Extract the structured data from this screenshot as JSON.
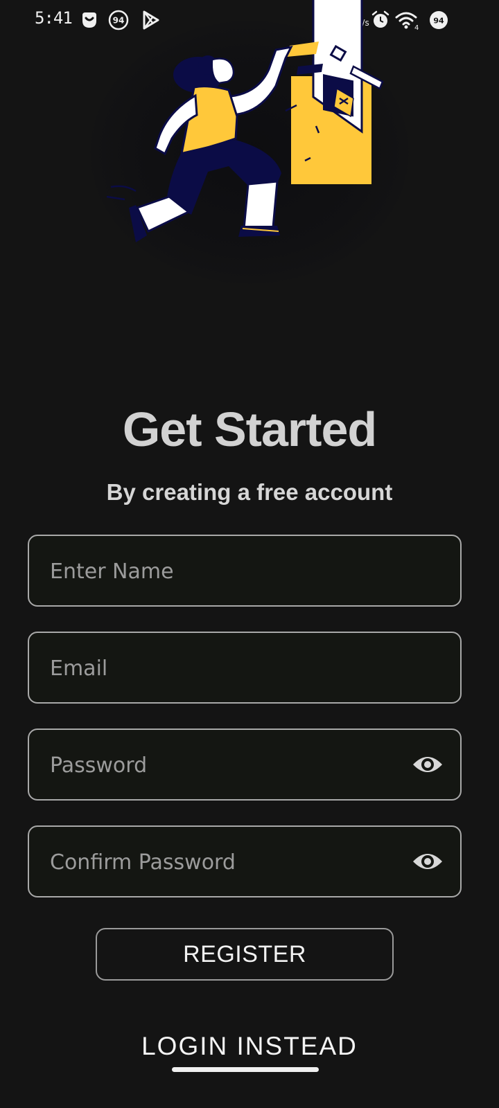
{
  "status_bar": {
    "time": "5:41",
    "net_speed_value": "0",
    "net_speed_unit": "kB/s",
    "notification_badge": "94",
    "battery_level": "94",
    "wifi_level": "4"
  },
  "illustration": {
    "subject": "woman-inserting-card-into-atm",
    "colors": {
      "navy": "#0b0c46",
      "yellow": "#ffc83a",
      "white": "#ffffff"
    }
  },
  "header": {
    "title": "Get Started",
    "subtitle": "By creating a free account"
  },
  "form": {
    "name": {
      "value": "",
      "placeholder": "Enter Name"
    },
    "email": {
      "value": "",
      "placeholder": "Email"
    },
    "password": {
      "value": "",
      "placeholder": "Password",
      "icon": "eye-icon"
    },
    "confirm_password": {
      "value": "",
      "placeholder": "Confirm Password",
      "icon": "eye-icon"
    }
  },
  "actions": {
    "register_label": "REGISTER",
    "login_label": "LOGIN INSTEAD"
  },
  "theme": {
    "background": "#141414",
    "field_border": "#a9a9a9",
    "text_primary": "#d2d2d2"
  }
}
